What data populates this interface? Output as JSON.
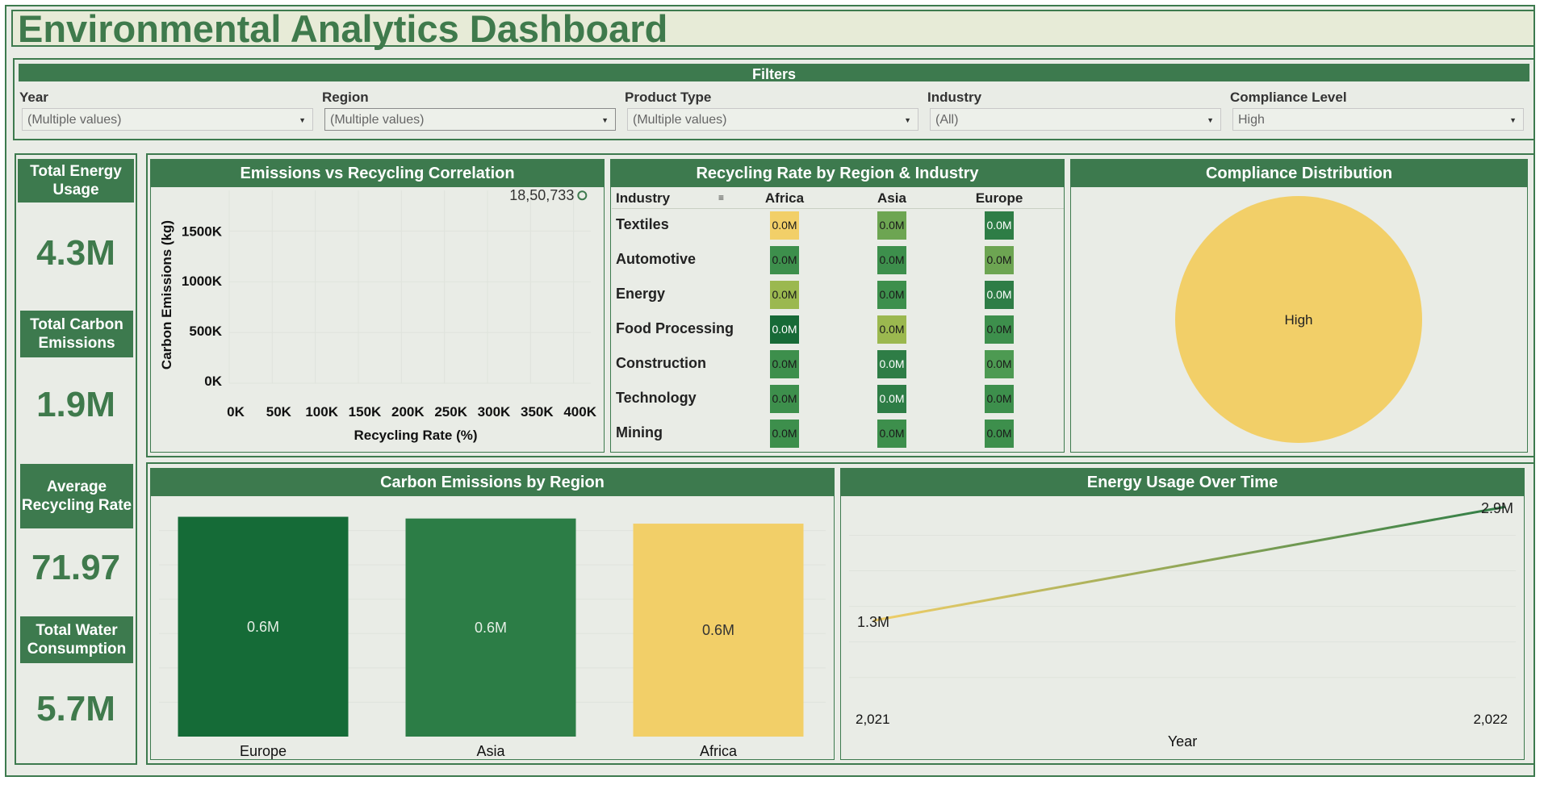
{
  "title": "Environmental Analytics Dashboard",
  "colors": {
    "primary": "#3d7a4e",
    "title_text": "#3f7a4c",
    "accent_yellow": "#f2cf68"
  },
  "filters": {
    "heading": "Filters",
    "items": [
      {
        "label": "Year",
        "value": "(Multiple values)"
      },
      {
        "label": "Region",
        "value": "(Multiple values)"
      },
      {
        "label": "Product Type",
        "value": "(Multiple values)"
      },
      {
        "label": "Industry",
        "value": "(All)"
      },
      {
        "label": "Compliance Level",
        "value": "High"
      }
    ],
    "caret_icon": "dropdown-caret-icon"
  },
  "kpis": [
    {
      "label": "Total Energy Usage",
      "value": "4.3M"
    },
    {
      "label": "Total Carbon Emissions",
      "value": "1.9M"
    },
    {
      "label": "Average Recycling Rate",
      "value": "71.97"
    },
    {
      "label": "Total Water Consumption",
      "value": "5.7M"
    }
  ],
  "scatter": {
    "title": "Emissions vs Recycling Correlation",
    "point_label": "18,50,733",
    "xlabel": "Recycling Rate (%)",
    "ylabel": "Carbon Emissions (kg)",
    "x_ticks": [
      "0K",
      "50K",
      "100K",
      "150K",
      "200K",
      "250K",
      "300K",
      "350K",
      "400K"
    ],
    "y_ticks": [
      "0K",
      "500K",
      "1000K",
      "1500K"
    ]
  },
  "heatmap": {
    "title": "Recycling Rate by Region & Industry",
    "row_header": "Industry",
    "sort_icon": "sort-descending-icon",
    "columns": [
      "Africa",
      "Asia",
      "Europe"
    ],
    "rows": [
      {
        "label": "Textiles",
        "cells": [
          "0.0M",
          "0.0M",
          "0.0M"
        ]
      },
      {
        "label": "Automotive",
        "cells": [
          "0.0M",
          "0.0M",
          "0.0M"
        ]
      },
      {
        "label": "Energy",
        "cells": [
          "0.0M",
          "0.0M",
          "0.0M"
        ]
      },
      {
        "label": "Food Processing",
        "cells": [
          "0.0M",
          "0.0M",
          "0.0M"
        ]
      },
      {
        "label": "Construction",
        "cells": [
          "0.0M",
          "0.0M",
          "0.0M"
        ]
      },
      {
        "label": "Technology",
        "cells": [
          "0.0M",
          "0.0M",
          "0.0M"
        ]
      },
      {
        "label": "Mining",
        "cells": [
          "0.0M",
          "0.0M",
          "0.0M"
        ]
      }
    ],
    "cell_colors": [
      [
        "#f2cf68",
        "#6da552",
        "#2e7d46"
      ],
      [
        "#3d8f4c",
        "#3d8f4c",
        "#6da552"
      ],
      [
        "#9bb84f",
        "#3d8f4c",
        "#2e7d46"
      ],
      [
        "#176a37",
        "#9bb84f",
        "#3d8f4c"
      ],
      [
        "#3d8f4c",
        "#2e7d46",
        "#4d9a52"
      ],
      [
        "#3d8f4c",
        "#2e7d46",
        "#3d8f4c"
      ],
      [
        "#3d8f4c",
        "#3d8f4c",
        "#3d8f4c"
      ]
    ]
  },
  "pie": {
    "title": "Compliance Distribution",
    "slice_label": "High"
  },
  "chart_data": [
    {
      "type": "scatter",
      "title": "Emissions vs Recycling Correlation",
      "xlabel": "Recycling Rate (%)",
      "ylabel": "Carbon Emissions (kg)",
      "xlim": [
        0,
        420000
      ],
      "ylim": [
        0,
        1900000
      ],
      "points": [
        {
          "x": 410000,
          "y": 1850733,
          "label": "18,50,733"
        }
      ]
    },
    {
      "type": "heatmap",
      "title": "Recycling Rate by Region & Industry",
      "columns": [
        "Africa",
        "Asia",
        "Europe"
      ],
      "rows": [
        "Textiles",
        "Automotive",
        "Energy",
        "Food Processing",
        "Construction",
        "Technology",
        "Mining"
      ]
    },
    {
      "type": "pie",
      "title": "Compliance Distribution",
      "slices": [
        {
          "label": "High",
          "value": 1,
          "color": "#f2cf68"
        }
      ]
    },
    {
      "type": "bar",
      "title": "Carbon Emissions by Region",
      "categories": [
        "Europe",
        "Asia",
        "Africa"
      ],
      "values": [
        0.64,
        0.635,
        0.62
      ],
      "labels": [
        "0.6M",
        "0.6M",
        "0.6M"
      ],
      "colors": [
        "#156b37",
        "#2c7d46",
        "#f2cf68"
      ],
      "ylim": [
        0,
        0.7
      ]
    },
    {
      "type": "line",
      "title": "Energy Usage Over Time",
      "xlabel": "Year",
      "x": [
        "2,021",
        "2,022"
      ],
      "y": [
        1.3,
        2.9
      ],
      "labels": [
        "1.3M",
        "2.9M"
      ],
      "ylim": [
        0.1,
        3.05
      ],
      "gradient": [
        "#f2cf68",
        "#2e7d46"
      ]
    }
  ]
}
